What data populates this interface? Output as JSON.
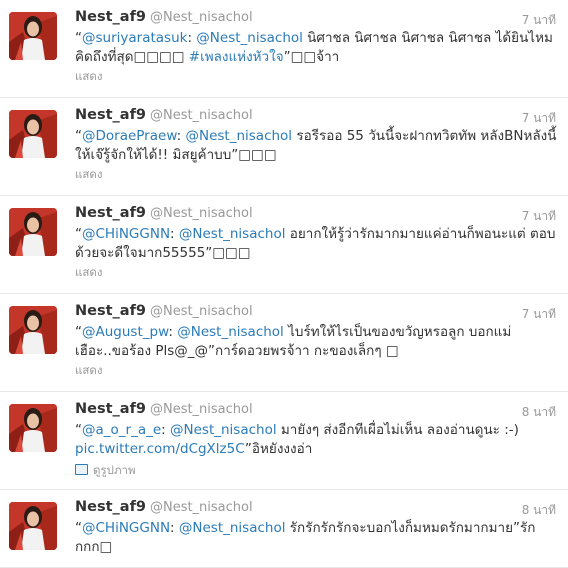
{
  "tweets": [
    {
      "name": "Nest_af9",
      "handle": "@Nest_nisachol",
      "time": "7 นาที",
      "text_parts": [
        {
          "t": "“",
          "link": false
        },
        {
          "t": "@suriyaratasuk",
          "link": true
        },
        {
          "t": ": ",
          "link": false
        },
        {
          "t": "@Nest_nisachol",
          "link": true
        },
        {
          "t": " นิศาชล นิศาชล นิศาชล นิศาชล ได้ยินไหม คิดถึงที่สุด□□□□ ",
          "link": false
        },
        {
          "t": "#เพลงแห่งหัวใจ",
          "link": true
        },
        {
          "t": "”□□จ้าา",
          "link": false
        }
      ],
      "action": "แสดง",
      "action_type": "show"
    },
    {
      "name": "Nest_af9",
      "handle": "@Nest_nisachol",
      "time": "7 นาที",
      "text_parts": [
        {
          "t": "“",
          "link": false
        },
        {
          "t": "@DoraePraew",
          "link": true
        },
        {
          "t": ": ",
          "link": false
        },
        {
          "t": "@Nest_nisachol",
          "link": true
        },
        {
          "t": " รอรีรออ 55 วันนี้จะฝากทวิตทัพ หลังBNหลังนี้ให้เจ๊รู้จักให้ได้!! มิสยูค้าบบ”□□□",
          "link": false
        }
      ],
      "action": "แสดง",
      "action_type": "show"
    },
    {
      "name": "Nest_af9",
      "handle": "@Nest_nisachol",
      "time": "7 นาที",
      "text_parts": [
        {
          "t": "“",
          "link": false
        },
        {
          "t": "@CHiNGGNN",
          "link": true
        },
        {
          "t": ": ",
          "link": false
        },
        {
          "t": "@Nest_nisachol",
          "link": true
        },
        {
          "t": " อยากให้รู้ว่ารักมากมายแค่อ่านก็พอนะแต่ ตอบด้วยจะดีใจมาก55555”□□□",
          "link": false
        }
      ],
      "action": "แสดง",
      "action_type": "show"
    },
    {
      "name": "Nest_af9",
      "handle": "@Nest_nisachol",
      "time": "7 นาที",
      "text_parts": [
        {
          "t": "“",
          "link": false
        },
        {
          "t": "@August_pw",
          "link": true
        },
        {
          "t": ": ",
          "link": false
        },
        {
          "t": "@Nest_nisachol",
          "link": true
        },
        {
          "t": " ไบร์ทให้ไรเป็นของขวัญหรอลูก บอกแม่ เฮือะ..ขอร้อง Pls@_@”การ์ดอวยพรจ้าา กะของเล็กๆ □",
          "link": false
        }
      ],
      "action": "แสดง",
      "action_type": "show"
    },
    {
      "name": "Nest_af9",
      "handle": "@Nest_nisachol",
      "time": "8 นาที",
      "text_parts": [
        {
          "t": "“",
          "link": false
        },
        {
          "t": "@a_o_r_a_e",
          "link": true
        },
        {
          "t": ": ",
          "link": false
        },
        {
          "t": "@Nest_nisachol",
          "link": true
        },
        {
          "t": " มายังๆ ส่งอีกทีเผื่อไม่เห็น ลองอ่านดูนะ :-) ",
          "link": false
        },
        {
          "t": "pic.twitter.com/dCgXlz5C",
          "link": true
        },
        {
          "t": "”อิหยังงงอ่า",
          "link": false
        }
      ],
      "action": "ดูรูปภาพ",
      "action_type": "media"
    },
    {
      "name": "Nest_af9",
      "handle": "@Nest_nisachol",
      "time": "8 นาที",
      "text_parts": [
        {
          "t": "“",
          "link": false
        },
        {
          "t": "@CHiNGGNN",
          "link": true
        },
        {
          "t": ": ",
          "link": false
        },
        {
          "t": "@Nest_nisachol",
          "link": true
        },
        {
          "t": " รักรักรักรักจะบอกไงก็มหมดรักมากมาย”รัก กกก□",
          "link": false
        }
      ],
      "action": "",
      "action_type": "none"
    }
  ]
}
